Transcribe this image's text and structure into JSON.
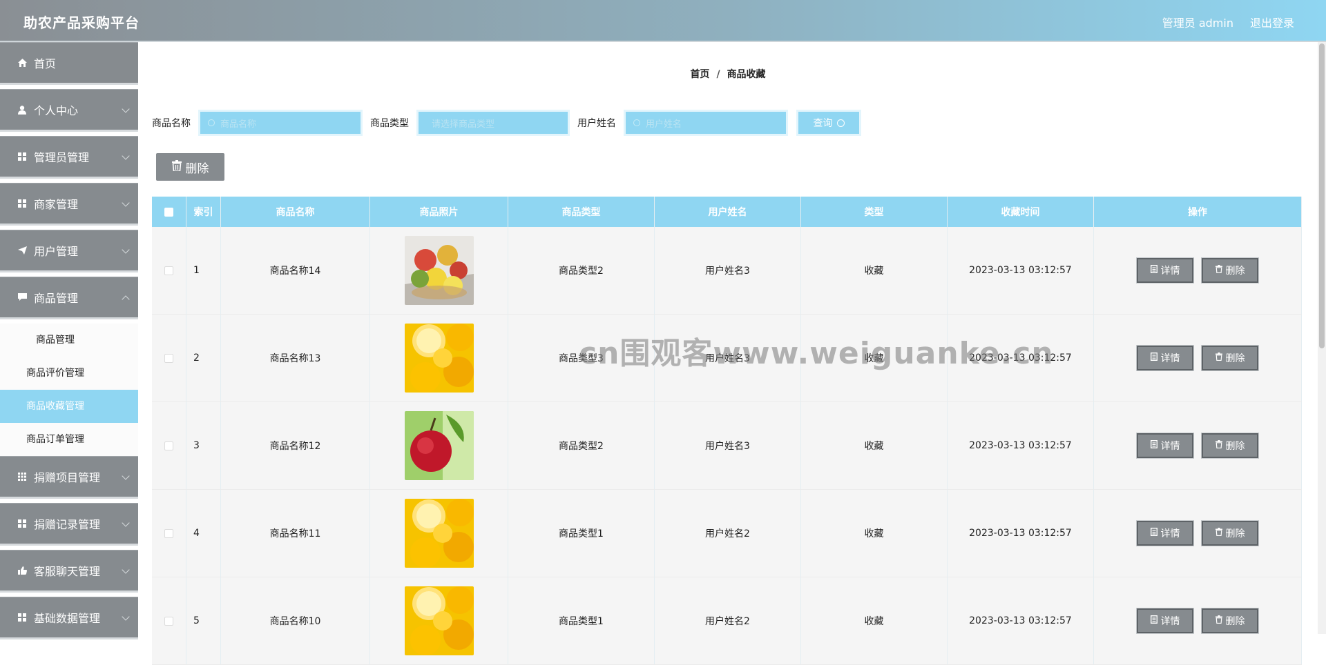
{
  "header": {
    "title": "助农产品采购平台",
    "user_label": "管理员 admin",
    "logout_label": "退出登录"
  },
  "sidebar": {
    "items": [
      {
        "label": "首页",
        "icon": "home-icon",
        "has_children": false
      },
      {
        "label": "个人中心",
        "icon": "user-icon",
        "has_children": true
      },
      {
        "label": "管理员管理",
        "icon": "grid-icon",
        "has_children": true
      },
      {
        "label": "商家管理",
        "icon": "grid-icon",
        "has_children": true
      },
      {
        "label": "用户管理",
        "icon": "send-icon",
        "has_children": true
      },
      {
        "label": "商品管理",
        "icon": "chat-icon",
        "has_children": true
      }
    ],
    "submenu": [
      {
        "label": "商品管理",
        "active": false
      },
      {
        "label": "商品评价管理",
        "active": false
      },
      {
        "label": "商品收藏管理",
        "active": true
      },
      {
        "label": "商品订单管理",
        "active": false
      }
    ],
    "items_after": [
      {
        "label": "捐赠项目管理",
        "icon": "grid-icon"
      },
      {
        "label": "捐赠记录管理",
        "icon": "grid-icon"
      },
      {
        "label": "客服聊天管理",
        "icon": "thumb-icon"
      },
      {
        "label": "基础数据管理",
        "icon": "grid-icon"
      }
    ]
  },
  "breadcrumb": {
    "home": "首页",
    "sep": "/",
    "current": "商品收藏"
  },
  "search": {
    "name_label": "商品名称",
    "name_placeholder": "商品名称",
    "type_label": "商品类型",
    "type_placeholder": "请选择商品类型",
    "user_label": "用户姓名",
    "user_placeholder": "用户姓名",
    "button": "查询"
  },
  "toolbar": {
    "delete_label": "删除"
  },
  "table": {
    "headers": [
      "索引",
      "商品名称",
      "商品照片",
      "商品类型",
      "用户姓名",
      "类型",
      "收藏时间",
      "操作"
    ],
    "detail_label": "详情",
    "delete_label": "删除",
    "rows": [
      {
        "index": "1",
        "name": "商品名称14",
        "photo": "mixed-fruit-photo",
        "type": "商品类型2",
        "user": "用户姓名3",
        "kind": "收藏",
        "time": "2023-03-13 03:12:57"
      },
      {
        "index": "2",
        "name": "商品名称13",
        "photo": "lemon-photo",
        "type": "商品类型3",
        "user": "用户姓名3",
        "kind": "收藏",
        "time": "2023-03-13 03:12:57"
      },
      {
        "index": "3",
        "name": "商品名称12",
        "photo": "apple-photo",
        "type": "商品类型2",
        "user": "用户姓名3",
        "kind": "收藏",
        "time": "2023-03-13 03:12:57"
      },
      {
        "index": "4",
        "name": "商品名称11",
        "photo": "lemon-photo",
        "type": "商品类型1",
        "user": "用户姓名2",
        "kind": "收藏",
        "time": "2023-03-13 03:12:57"
      },
      {
        "index": "5",
        "name": "商品名称10",
        "photo": "lemon-photo",
        "type": "商品类型1",
        "user": "用户姓名2",
        "kind": "收藏",
        "time": "2023-03-13 03:12:57"
      }
    ]
  },
  "watermark": "cn围观客www.weiguanke.cn",
  "colors": {
    "accent": "#8fd6f2",
    "gray": "#868b8f"
  }
}
